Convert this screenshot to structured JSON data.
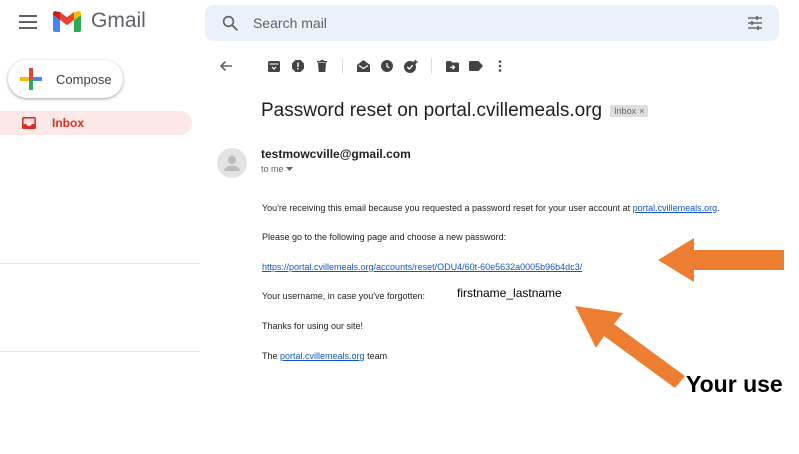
{
  "header": {
    "app_name": "Gmail",
    "search_placeholder": "Search mail"
  },
  "sidebar": {
    "compose_label": "Compose",
    "inbox_label": "Inbox"
  },
  "email": {
    "subject": "Password reset on portal.cvillemeals.org",
    "label_chip": "Inbox",
    "label_close": "×",
    "sender": "testmowcville@gmail.com",
    "to": "to me",
    "line1_text": "You're receiving this email because you requested a password reset for your user account at ",
    "line1_link": "portal.cvillemeals.org",
    "line1_end": ".",
    "line2": "Please go to the following page and choose a new password:",
    "reset_link": "https://portal.cvillemeals.org/accounts/reset/ODU4/60t-60e5632a0005b96b4dc3/",
    "line4": "Your username, in case you've forgotten: ",
    "username": "firstname_lastname",
    "line5": "Thanks for using our site!",
    "line6_prefix": "The ",
    "line6_link": "portal.cvillemeals.org",
    "line6_suffix": " team"
  },
  "annotation": {
    "text": "Your use",
    "color": "#ed7d31"
  },
  "colors": {
    "accent_red": "#d93025",
    "search_bg": "#eaf1fb",
    "inbox_bg": "#fce8e6",
    "link": "#1155cc"
  }
}
